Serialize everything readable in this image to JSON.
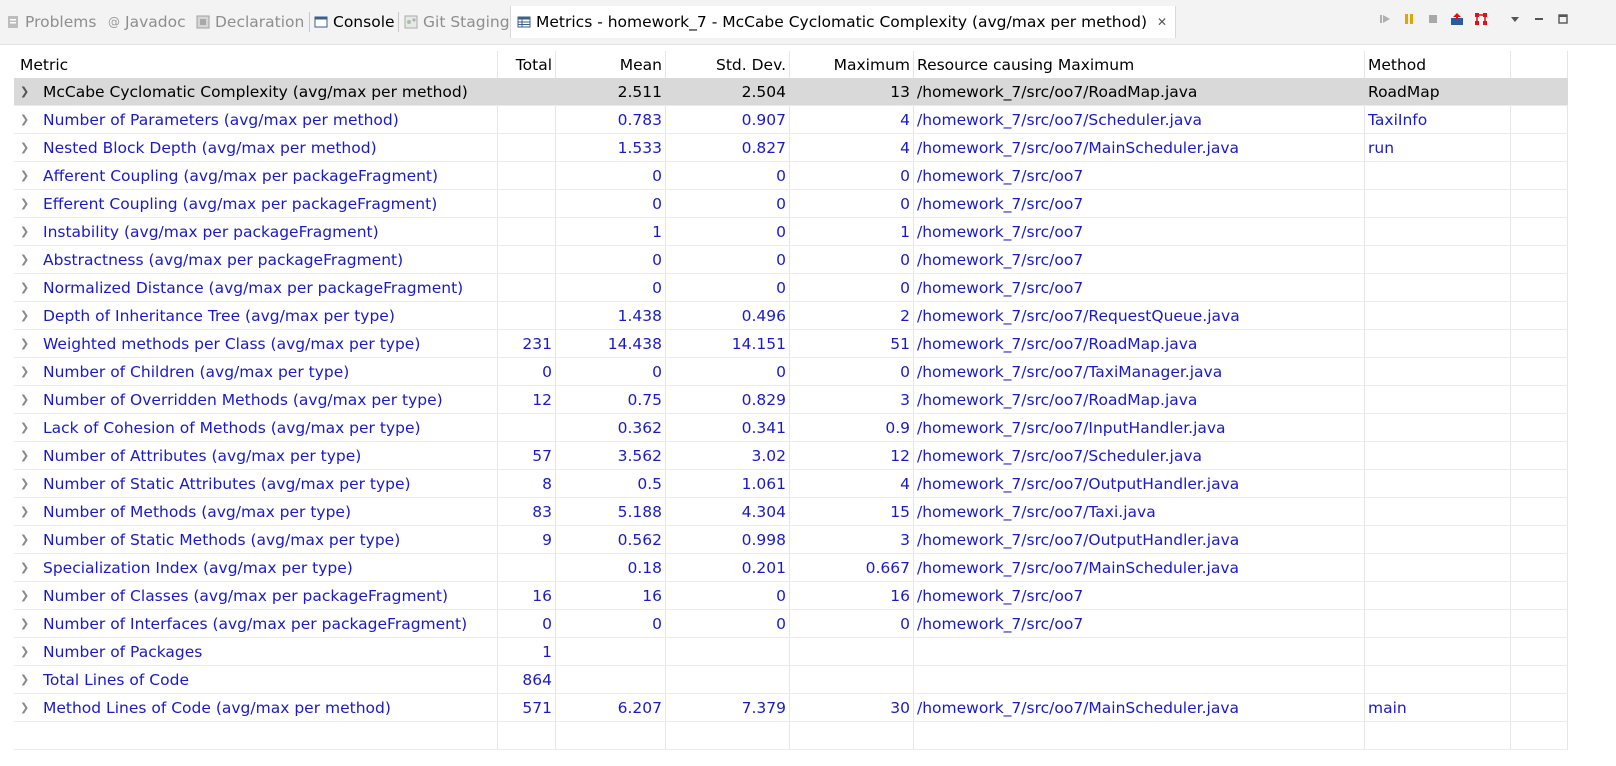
{
  "tabs": {
    "problems": "Problems",
    "javadoc": "Javadoc",
    "declaration": "Declaration",
    "console": "Console",
    "git_staging": "Git Staging",
    "metrics": "Metrics - homework_7 - McCabe Cyclomatic Complexity (avg/max per method)",
    "close_glyph": "✕"
  },
  "colors": {
    "link": "#1a1acc",
    "selected_row": "#d9d9d9",
    "toolbar_orange": "#e4a400",
    "toolbar_red": "#e21010",
    "toolbar_blue": "#2c5aa0"
  },
  "table": {
    "headers": {
      "metric": "Metric",
      "total": "Total",
      "mean": "Mean",
      "std": "Std. Dev.",
      "max": "Maximum",
      "resource": "Resource causing Maximum",
      "method": "Method"
    },
    "rows": [
      {
        "metric": "McCabe Cyclomatic Complexity (avg/max per method)",
        "total": "",
        "mean": "2.511",
        "std": "2.504",
        "max": "13",
        "resource": "/homework_7/src/oo7/RoadMap.java",
        "method": "RoadMap"
      },
      {
        "metric": "Number of Parameters (avg/max per method)",
        "total": "",
        "mean": "0.783",
        "std": "0.907",
        "max": "4",
        "resource": "/homework_7/src/oo7/Scheduler.java",
        "method": "TaxiInfo"
      },
      {
        "metric": "Nested Block Depth (avg/max per method)",
        "total": "",
        "mean": "1.533",
        "std": "0.827",
        "max": "4",
        "resource": "/homework_7/src/oo7/MainScheduler.java",
        "method": "run"
      },
      {
        "metric": "Afferent Coupling (avg/max per packageFragment)",
        "total": "",
        "mean": "0",
        "std": "0",
        "max": "0",
        "resource": "/homework_7/src/oo7",
        "method": ""
      },
      {
        "metric": "Efferent Coupling (avg/max per packageFragment)",
        "total": "",
        "mean": "0",
        "std": "0",
        "max": "0",
        "resource": "/homework_7/src/oo7",
        "method": ""
      },
      {
        "metric": "Instability (avg/max per packageFragment)",
        "total": "",
        "mean": "1",
        "std": "0",
        "max": "1",
        "resource": "/homework_7/src/oo7",
        "method": ""
      },
      {
        "metric": "Abstractness (avg/max per packageFragment)",
        "total": "",
        "mean": "0",
        "std": "0",
        "max": "0",
        "resource": "/homework_7/src/oo7",
        "method": ""
      },
      {
        "metric": "Normalized Distance (avg/max per packageFragment)",
        "total": "",
        "mean": "0",
        "std": "0",
        "max": "0",
        "resource": "/homework_7/src/oo7",
        "method": ""
      },
      {
        "metric": "Depth of Inheritance Tree (avg/max per type)",
        "total": "",
        "mean": "1.438",
        "std": "0.496",
        "max": "2",
        "resource": "/homework_7/src/oo7/RequestQueue.java",
        "method": ""
      },
      {
        "metric": "Weighted methods per Class (avg/max per type)",
        "total": "231",
        "mean": "14.438",
        "std": "14.151",
        "max": "51",
        "resource": "/homework_7/src/oo7/RoadMap.java",
        "method": ""
      },
      {
        "metric": "Number of Children (avg/max per type)",
        "total": "0",
        "mean": "0",
        "std": "0",
        "max": "0",
        "resource": "/homework_7/src/oo7/TaxiManager.java",
        "method": ""
      },
      {
        "metric": "Number of Overridden Methods (avg/max per type)",
        "total": "12",
        "mean": "0.75",
        "std": "0.829",
        "max": "3",
        "resource": "/homework_7/src/oo7/RoadMap.java",
        "method": ""
      },
      {
        "metric": "Lack of Cohesion of Methods (avg/max per type)",
        "total": "",
        "mean": "0.362",
        "std": "0.341",
        "max": "0.9",
        "resource": "/homework_7/src/oo7/InputHandler.java",
        "method": ""
      },
      {
        "metric": "Number of Attributes (avg/max per type)",
        "total": "57",
        "mean": "3.562",
        "std": "3.02",
        "max": "12",
        "resource": "/homework_7/src/oo7/Scheduler.java",
        "method": ""
      },
      {
        "metric": "Number of Static Attributes (avg/max per type)",
        "total": "8",
        "mean": "0.5",
        "std": "1.061",
        "max": "4",
        "resource": "/homework_7/src/oo7/OutputHandler.java",
        "method": ""
      },
      {
        "metric": "Number of Methods (avg/max per type)",
        "total": "83",
        "mean": "5.188",
        "std": "4.304",
        "max": "15",
        "resource": "/homework_7/src/oo7/Taxi.java",
        "method": ""
      },
      {
        "metric": "Number of Static Methods (avg/max per type)",
        "total": "9",
        "mean": "0.562",
        "std": "0.998",
        "max": "3",
        "resource": "/homework_7/src/oo7/OutputHandler.java",
        "method": ""
      },
      {
        "metric": "Specialization Index (avg/max per type)",
        "total": "",
        "mean": "0.18",
        "std": "0.201",
        "max": "0.667",
        "resource": "/homework_7/src/oo7/MainScheduler.java",
        "method": ""
      },
      {
        "metric": "Number of Classes (avg/max per packageFragment)",
        "total": "16",
        "mean": "16",
        "std": "0",
        "max": "16",
        "resource": "/homework_7/src/oo7",
        "method": ""
      },
      {
        "metric": "Number of Interfaces (avg/max per packageFragment)",
        "total": "0",
        "mean": "0",
        "std": "0",
        "max": "0",
        "resource": "/homework_7/src/oo7",
        "method": ""
      },
      {
        "metric": "Number of Packages",
        "total": "1",
        "mean": "",
        "std": "",
        "max": "",
        "resource": "",
        "method": ""
      },
      {
        "metric": "Total Lines of Code",
        "total": "864",
        "mean": "",
        "std": "",
        "max": "",
        "resource": "",
        "method": ""
      },
      {
        "metric": "Method Lines of Code (avg/max per method)",
        "total": "571",
        "mean": "6.207",
        "std": "7.379",
        "max": "30",
        "resource": "/homework_7/src/oo7/MainScheduler.java",
        "method": "main"
      }
    ]
  }
}
